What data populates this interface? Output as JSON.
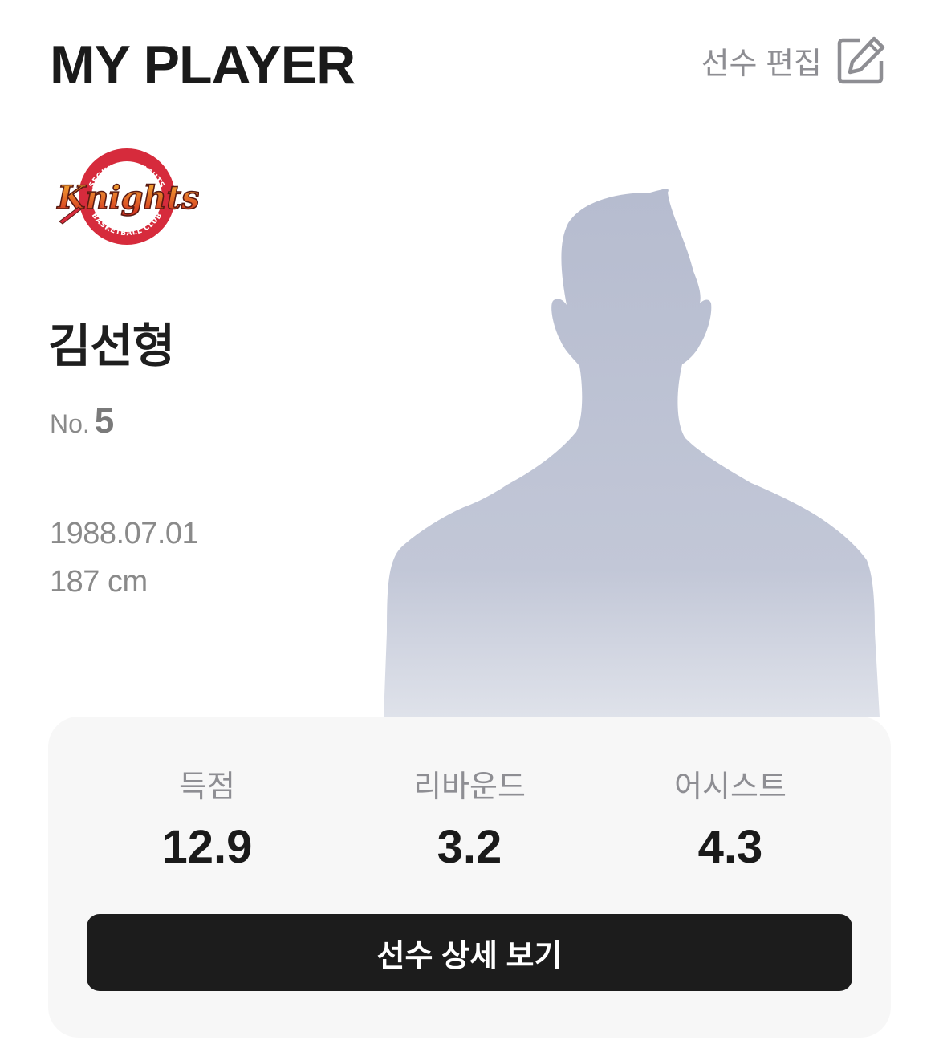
{
  "header": {
    "title": "MY PLAYER",
    "edit_label": "선수 편집",
    "edit_icon": "pencil-square-icon"
  },
  "team": {
    "logo_top_text": "SEOUL SK KNIGHTS",
    "logo_main_text": "Knights",
    "logo_bottom_text": "BASKETBALL CLUB",
    "logo_color": "#d62b3c"
  },
  "player": {
    "name": "김선형",
    "number_prefix": "No.",
    "number": "5",
    "birthdate": "1988.07.01",
    "height": "187 cm",
    "photo_icon": "person-silhouette-icon"
  },
  "stats": [
    {
      "label": "득점",
      "value": "12.9"
    },
    {
      "label": "리바운드",
      "value": "3.2"
    },
    {
      "label": "어시스트",
      "value": "4.3"
    }
  ],
  "detail_button_label": "선수 상세 보기",
  "colors": {
    "accent_dark": "#1c1c1c",
    "muted_text": "#8e8e93",
    "card_bg": "#f7f7f7",
    "silhouette": "#b9bfd1"
  }
}
